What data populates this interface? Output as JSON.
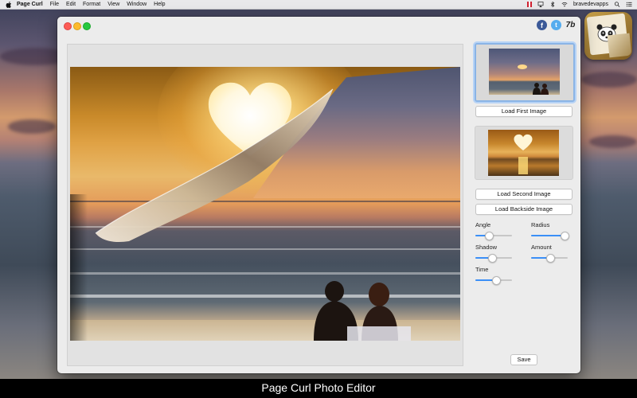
{
  "menubar": {
    "items": [
      "Page Curl",
      "File",
      "Edit",
      "Format",
      "View",
      "Window",
      "Help"
    ],
    "user": "bravedevapps"
  },
  "window": {
    "social": {
      "facebook": "f",
      "twitter": "t",
      "developer": "7b"
    }
  },
  "panel": {
    "load_first": "Load First Image",
    "load_second": "Load Second Image",
    "load_backside": "Load Backside Image",
    "sliders": [
      {
        "label": "Angle",
        "value": 0.35
      },
      {
        "label": "Radius",
        "value": 0.9
      },
      {
        "label": "Shadow",
        "value": 0.45
      },
      {
        "label": "Amount",
        "value": 0.5
      },
      {
        "label": "Time",
        "value": 0.55
      }
    ],
    "save": "Save"
  },
  "caption": "Page Curl Photo Editor",
  "colors": {
    "accent": "#3b8ff7",
    "close": "#fd5c56",
    "minimize": "#fdbb2e",
    "maximize": "#28c840",
    "facebook": "#3b5998",
    "twitter": "#55acee"
  }
}
